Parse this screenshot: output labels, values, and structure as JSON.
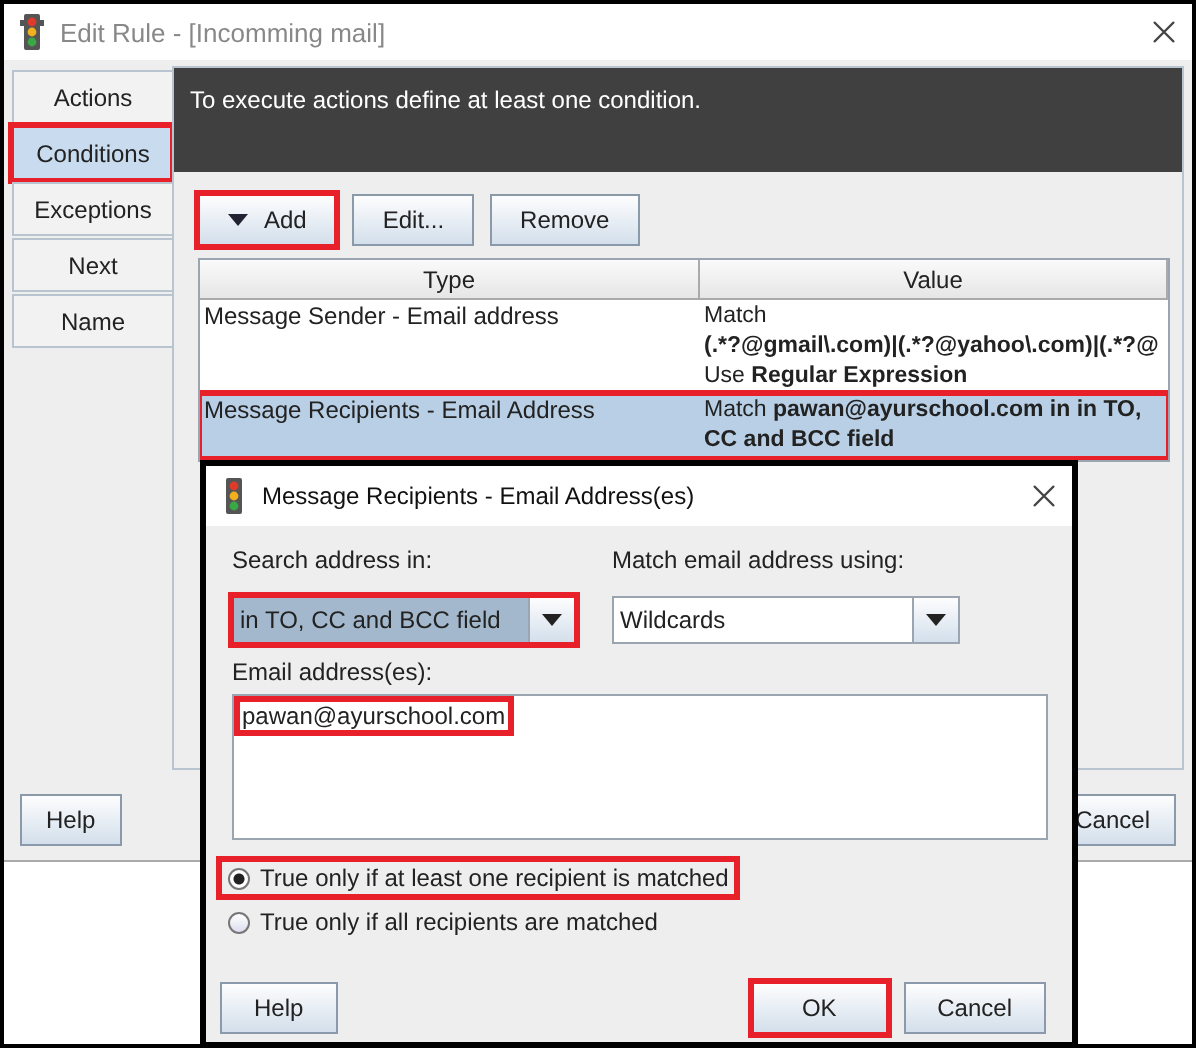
{
  "window": {
    "title": "Edit Rule - [Incomming mail]"
  },
  "tabs": [
    {
      "label": "Actions",
      "selected": false,
      "highlighted": false
    },
    {
      "label": "Conditions",
      "selected": true,
      "highlighted": true
    },
    {
      "label": "Exceptions",
      "selected": false,
      "highlighted": false
    },
    {
      "label": "Next",
      "selected": false,
      "highlighted": false
    },
    {
      "label": "Name",
      "selected": false,
      "highlighted": false
    }
  ],
  "banner": "To execute actions define at least one condition.",
  "toolbar": [
    {
      "label": "Add",
      "kind": "dropdown",
      "highlighted": true
    },
    {
      "label": "Edit...",
      "kind": "plain",
      "highlighted": false
    },
    {
      "label": "Remove",
      "kind": "plain",
      "highlighted": false
    }
  ],
  "table": {
    "columns": [
      "Type",
      "Value"
    ],
    "rows": [
      {
        "type": "Message Sender - Email address",
        "value": [
          {
            "kind": "plain",
            "text": "Match"
          },
          {
            "kind": "bold",
            "text": "(.*?@gmail\\.com)|(.*?@yahoo\\.com)|(.*?@"
          },
          {
            "kind": "rich",
            "text": "Use **Regular Expression**"
          }
        ],
        "selected": false,
        "highlighted": false
      },
      {
        "type": "Message Recipients - Email Address",
        "value": [
          {
            "kind": "rich",
            "text": "Match **pawan@ayurschool.com in in TO,**"
          },
          {
            "kind": "bold",
            "text": "CC and BCC field"
          }
        ],
        "selected": true,
        "highlighted": true
      }
    ]
  },
  "footer_buttons": [
    "Help",
    "Cancel"
  ],
  "dialog": {
    "title": "Message Recipients - Email Address(es)",
    "search_label": "Search address in:",
    "search_value": "in TO, CC and BCC field",
    "search_focused": true,
    "search_highlighted": true,
    "match_label": "Match email address using:",
    "match_value": "Wildcards",
    "match_highlighted": false,
    "email_label": "Email address(es):",
    "email_value": "pawan@ayurschool.com",
    "email_highlighted": true,
    "options": [
      {
        "label": "True only if at least one recipient is matched",
        "selected": true,
        "highlighted": true
      },
      {
        "label": "True only if all recipients are matched",
        "selected": false,
        "highlighted": false
      }
    ],
    "buttons": [
      {
        "label": "Help",
        "highlighted": false
      },
      {
        "label": "OK",
        "highlighted": true
      },
      {
        "label": "Cancel",
        "highlighted": false
      }
    ]
  }
}
